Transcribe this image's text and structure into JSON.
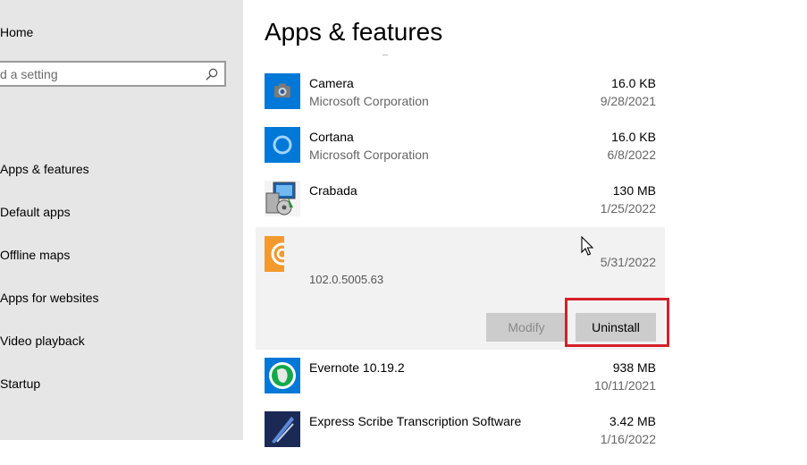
{
  "sidebar": {
    "home_label": "Home",
    "search_placeholder": "d a setting",
    "items": [
      {
        "label": "Apps & features"
      },
      {
        "label": "Default apps"
      },
      {
        "label": "Offline maps"
      },
      {
        "label": "Apps for websites"
      },
      {
        "label": "Video playback"
      },
      {
        "label": "Startup"
      }
    ]
  },
  "main": {
    "title": "Apps & features",
    "apps": [
      {
        "name": "Camera",
        "publisher": "Microsoft Corporation",
        "size": "16.0 KB",
        "date": "9/28/2021",
        "icon": "camera-icon"
      },
      {
        "name": "Cortana",
        "publisher": "Microsoft Corporation",
        "size": "16.0 KB",
        "date": "6/8/2022",
        "icon": "cortana-icon"
      },
      {
        "name": "Crabada",
        "publisher": "",
        "size": "130 MB",
        "date": "1/25/2022",
        "icon": "installer-icon"
      },
      {
        "name": "Evernote 10.19.2",
        "publisher": "",
        "size": "938 MB",
        "date": "10/11/2021",
        "icon": "evernote-icon"
      },
      {
        "name": "Express Scribe Transcription Software",
        "publisher": "",
        "size": "3.42 MB",
        "date": "1/16/2022",
        "icon": "express-scribe-icon"
      }
    ],
    "selected_app": {
      "date": "5/31/2022",
      "version": "102.0.5005.63",
      "icon": "orange-app-icon",
      "modify_label": "Modify",
      "uninstall_label": "Uninstall"
    }
  },
  "colors": {
    "sidebar_bg": "#e6e6e6",
    "accent_blue": "#0078d7",
    "highlight_red": "#d61f2a"
  }
}
